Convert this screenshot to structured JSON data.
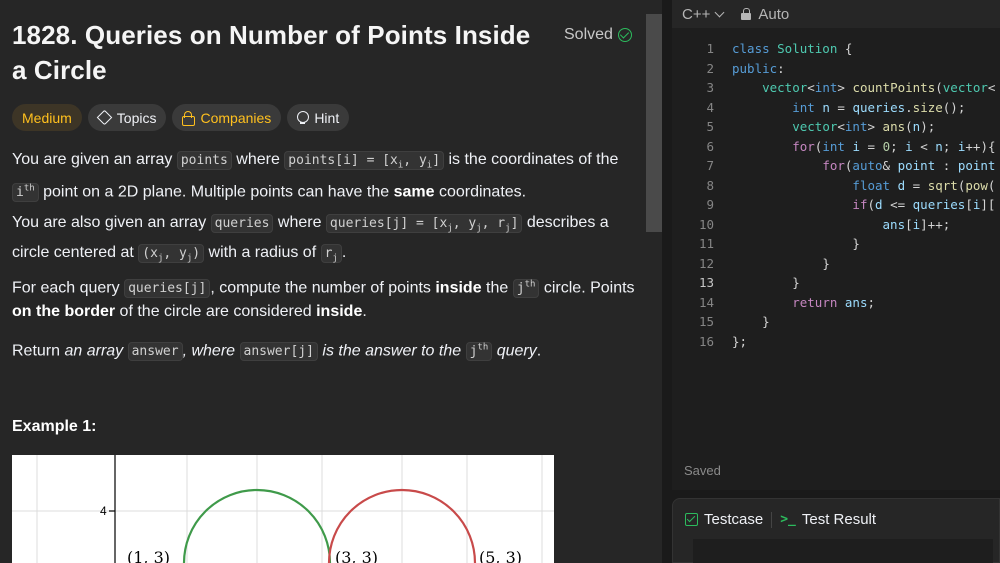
{
  "problem": {
    "title": "1828. Queries on Number of Points Inside a Circle",
    "status": "Solved",
    "tags": {
      "difficulty": "Medium",
      "topics": "Topics",
      "companies": "Companies",
      "hint": "Hint"
    },
    "example_title": "Example 1:"
  },
  "description": {
    "p1": {
      "t1": "You are given an array ",
      "c1": "points",
      "t2": " where ",
      "c2a": "points[i] = [x",
      "c2sub1": "i",
      "c2b": ", y",
      "c2sub2": "i",
      "c2c": "]",
      "t3": " is the coordinates of the ",
      "c3": "i",
      "c3sup": "th",
      "t4": " point on a 2D plane. Multiple points can have the ",
      "b1": "same",
      "t5": " coordinates."
    },
    "p2": {
      "t1": "You are also given an array ",
      "c1": "queries",
      "t2": " where ",
      "c2a": "queries[j] = [x",
      "c2sub1": "j",
      "c2b": ", y",
      "c2sub2": "j",
      "c2c": ", r",
      "c2sub3": "j",
      "c2d": "]",
      "t3": " describes a circle centered at ",
      "c3a": "(x",
      "c3sub1": "j",
      "c3b": ", y",
      "c3sub2": "j",
      "c3c": ")",
      "t4": " with a radius of ",
      "c4": "r",
      "c4sub": "j",
      "t5": "."
    },
    "p3": {
      "t1": "For each query ",
      "c1": "queries[j]",
      "t2": ", compute the number of points ",
      "b1": "inside",
      "t3": " the ",
      "c2": "j",
      "c2sup": "th",
      "t4": " circle. Points ",
      "b2": "on the border",
      "t5": " of the circle are considered ",
      "b3": "inside",
      "t6": "."
    },
    "p4": {
      "t1": "Return ",
      "i1": "an array ",
      "c1": "answer",
      "i2": ", where ",
      "c2": "answer[j]",
      "i3": " is the answer to the ",
      "c3": "j",
      "c3sup": "th",
      "i4": " query",
      "t2": "."
    }
  },
  "figure": {
    "y_tick": "4",
    "points": [
      {
        "label": "(1, 3)"
      },
      {
        "label": "(3, 3)"
      },
      {
        "label": "(5, 3)"
      }
    ],
    "colors": {
      "circle1": "#3f9a4a",
      "circle2": "#c84a4a"
    }
  },
  "editor": {
    "language": "C++",
    "mode": "Auto",
    "saved": "Saved",
    "lines": [
      {
        "n": "1",
        "tokens": [
          [
            "kw",
            "class "
          ],
          [
            "ty",
            "Solution "
          ],
          [
            "",
            "{"
          ]
        ]
      },
      {
        "n": "2",
        "tokens": [
          [
            "kw",
            "public"
          ],
          [
            "",
            ":"
          ]
        ]
      },
      {
        "n": "3",
        "tokens": [
          [
            "",
            "    "
          ],
          [
            "ty",
            "vector"
          ],
          [
            "",
            "<"
          ],
          [
            "kw",
            "int"
          ],
          [
            "",
            "> "
          ],
          [
            "fn",
            "countPoints"
          ],
          [
            "",
            "("
          ],
          [
            "ty",
            "vector"
          ],
          [
            "",
            "<"
          ]
        ]
      },
      {
        "n": "4",
        "tokens": [
          [
            "",
            "        "
          ],
          [
            "kw",
            "int "
          ],
          [
            "va",
            "n "
          ],
          [
            "",
            "= "
          ],
          [
            "va",
            "queries"
          ],
          [
            "",
            "."
          ],
          [
            "fn",
            "size"
          ],
          [
            "",
            "();"
          ]
        ]
      },
      {
        "n": "5",
        "tokens": [
          [
            "",
            "        "
          ],
          [
            "ty",
            "vector"
          ],
          [
            "",
            "<"
          ],
          [
            "kw",
            "int"
          ],
          [
            "",
            "> "
          ],
          [
            "fn",
            "ans"
          ],
          [
            "",
            "("
          ],
          [
            "va",
            "n"
          ],
          [
            "",
            ");"
          ]
        ]
      },
      {
        "n": "6",
        "tokens": [
          [
            "",
            "        "
          ],
          [
            "ctl",
            "for"
          ],
          [
            "",
            "("
          ],
          [
            "kw",
            "int "
          ],
          [
            "va",
            "i "
          ],
          [
            "",
            "= "
          ],
          [
            "nu",
            "0"
          ],
          [
            "",
            "; "
          ],
          [
            "va",
            "i "
          ],
          [
            "",
            "< "
          ],
          [
            "va",
            "n"
          ],
          [
            "",
            "; "
          ],
          [
            "va",
            "i"
          ],
          [
            "",
            "++){"
          ]
        ]
      },
      {
        "n": "7",
        "tokens": [
          [
            "",
            "            "
          ],
          [
            "ctl",
            "for"
          ],
          [
            "",
            "("
          ],
          [
            "kw",
            "auto"
          ],
          [
            "",
            "& "
          ],
          [
            "va",
            "point "
          ],
          [
            "",
            ": "
          ],
          [
            "va",
            "point"
          ]
        ]
      },
      {
        "n": "8",
        "tokens": [
          [
            "",
            "                "
          ],
          [
            "kw",
            "float "
          ],
          [
            "va",
            "d "
          ],
          [
            "",
            "= "
          ],
          [
            "fn",
            "sqrt"
          ],
          [
            "",
            "("
          ],
          [
            "fn",
            "pow"
          ],
          [
            "",
            "("
          ]
        ]
      },
      {
        "n": "9",
        "tokens": [
          [
            "",
            "                "
          ],
          [
            "ctl",
            "if"
          ],
          [
            "",
            "("
          ],
          [
            "va",
            "d "
          ],
          [
            "",
            "<= "
          ],
          [
            "va",
            "queries"
          ],
          [
            "",
            "["
          ],
          [
            "va",
            "i"
          ],
          [
            "",
            "]["
          ]
        ]
      },
      {
        "n": "10",
        "tokens": [
          [
            "",
            "                    "
          ],
          [
            "va",
            "ans"
          ],
          [
            "",
            "["
          ],
          [
            "va",
            "i"
          ],
          [
            "",
            "]++;"
          ]
        ]
      },
      {
        "n": "11",
        "tokens": [
          [
            "",
            "                "
          ],
          [
            "",
            "}"
          ]
        ]
      },
      {
        "n": "12",
        "tokens": [
          [
            "",
            "            "
          ],
          [
            "",
            "}"
          ]
        ]
      },
      {
        "n": "13",
        "tokens": [
          [
            "",
            "        "
          ],
          [
            "",
            "}"
          ]
        ]
      },
      {
        "n": "14",
        "tokens": [
          [
            "",
            "        "
          ],
          [
            "ctl",
            "return "
          ],
          [
            "va",
            "ans"
          ],
          [
            "",
            ";"
          ]
        ]
      },
      {
        "n": "15",
        "tokens": [
          [
            "",
            "    "
          ],
          [
            "",
            "}"
          ]
        ]
      },
      {
        "n": "16",
        "tokens": [
          [
            "",
            "};"
          ]
        ]
      }
    ],
    "active_line": "13"
  },
  "bottom": {
    "testcase": "Testcase",
    "test_result": "Test Result",
    "term_icon": ">_"
  }
}
